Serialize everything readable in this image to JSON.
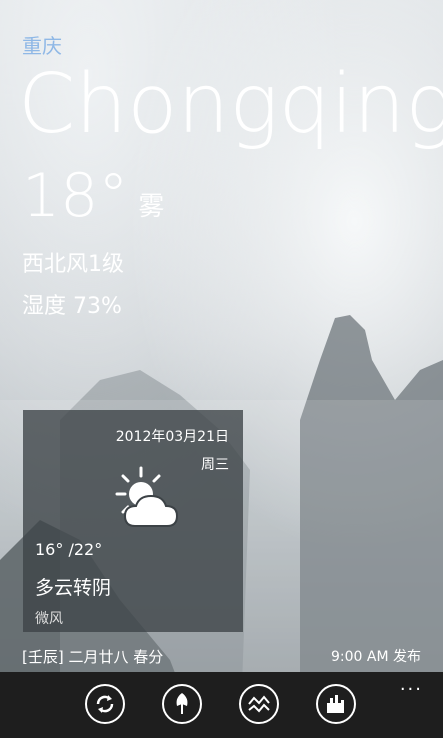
{
  "header": {
    "city_cn": "重庆",
    "city_en": "Chongqing",
    "temperature": "18°",
    "condition": "雾",
    "wind": "西北风1级",
    "humidity": "湿度 73%"
  },
  "forecast_card": {
    "date": "2012年03月21日",
    "weekday": "周三",
    "icon": "partly-cloudy-icon",
    "range": "16° /22°",
    "condition": "多云转阴",
    "wind": "微风"
  },
  "footer": {
    "lunar": "[壬辰] 二月廿八 春分",
    "published": "9:00 AM 发布"
  },
  "appbar": {
    "buttons": [
      "refresh-icon",
      "umbrella-icon",
      "share-icon",
      "city-icon"
    ],
    "more": "..."
  }
}
